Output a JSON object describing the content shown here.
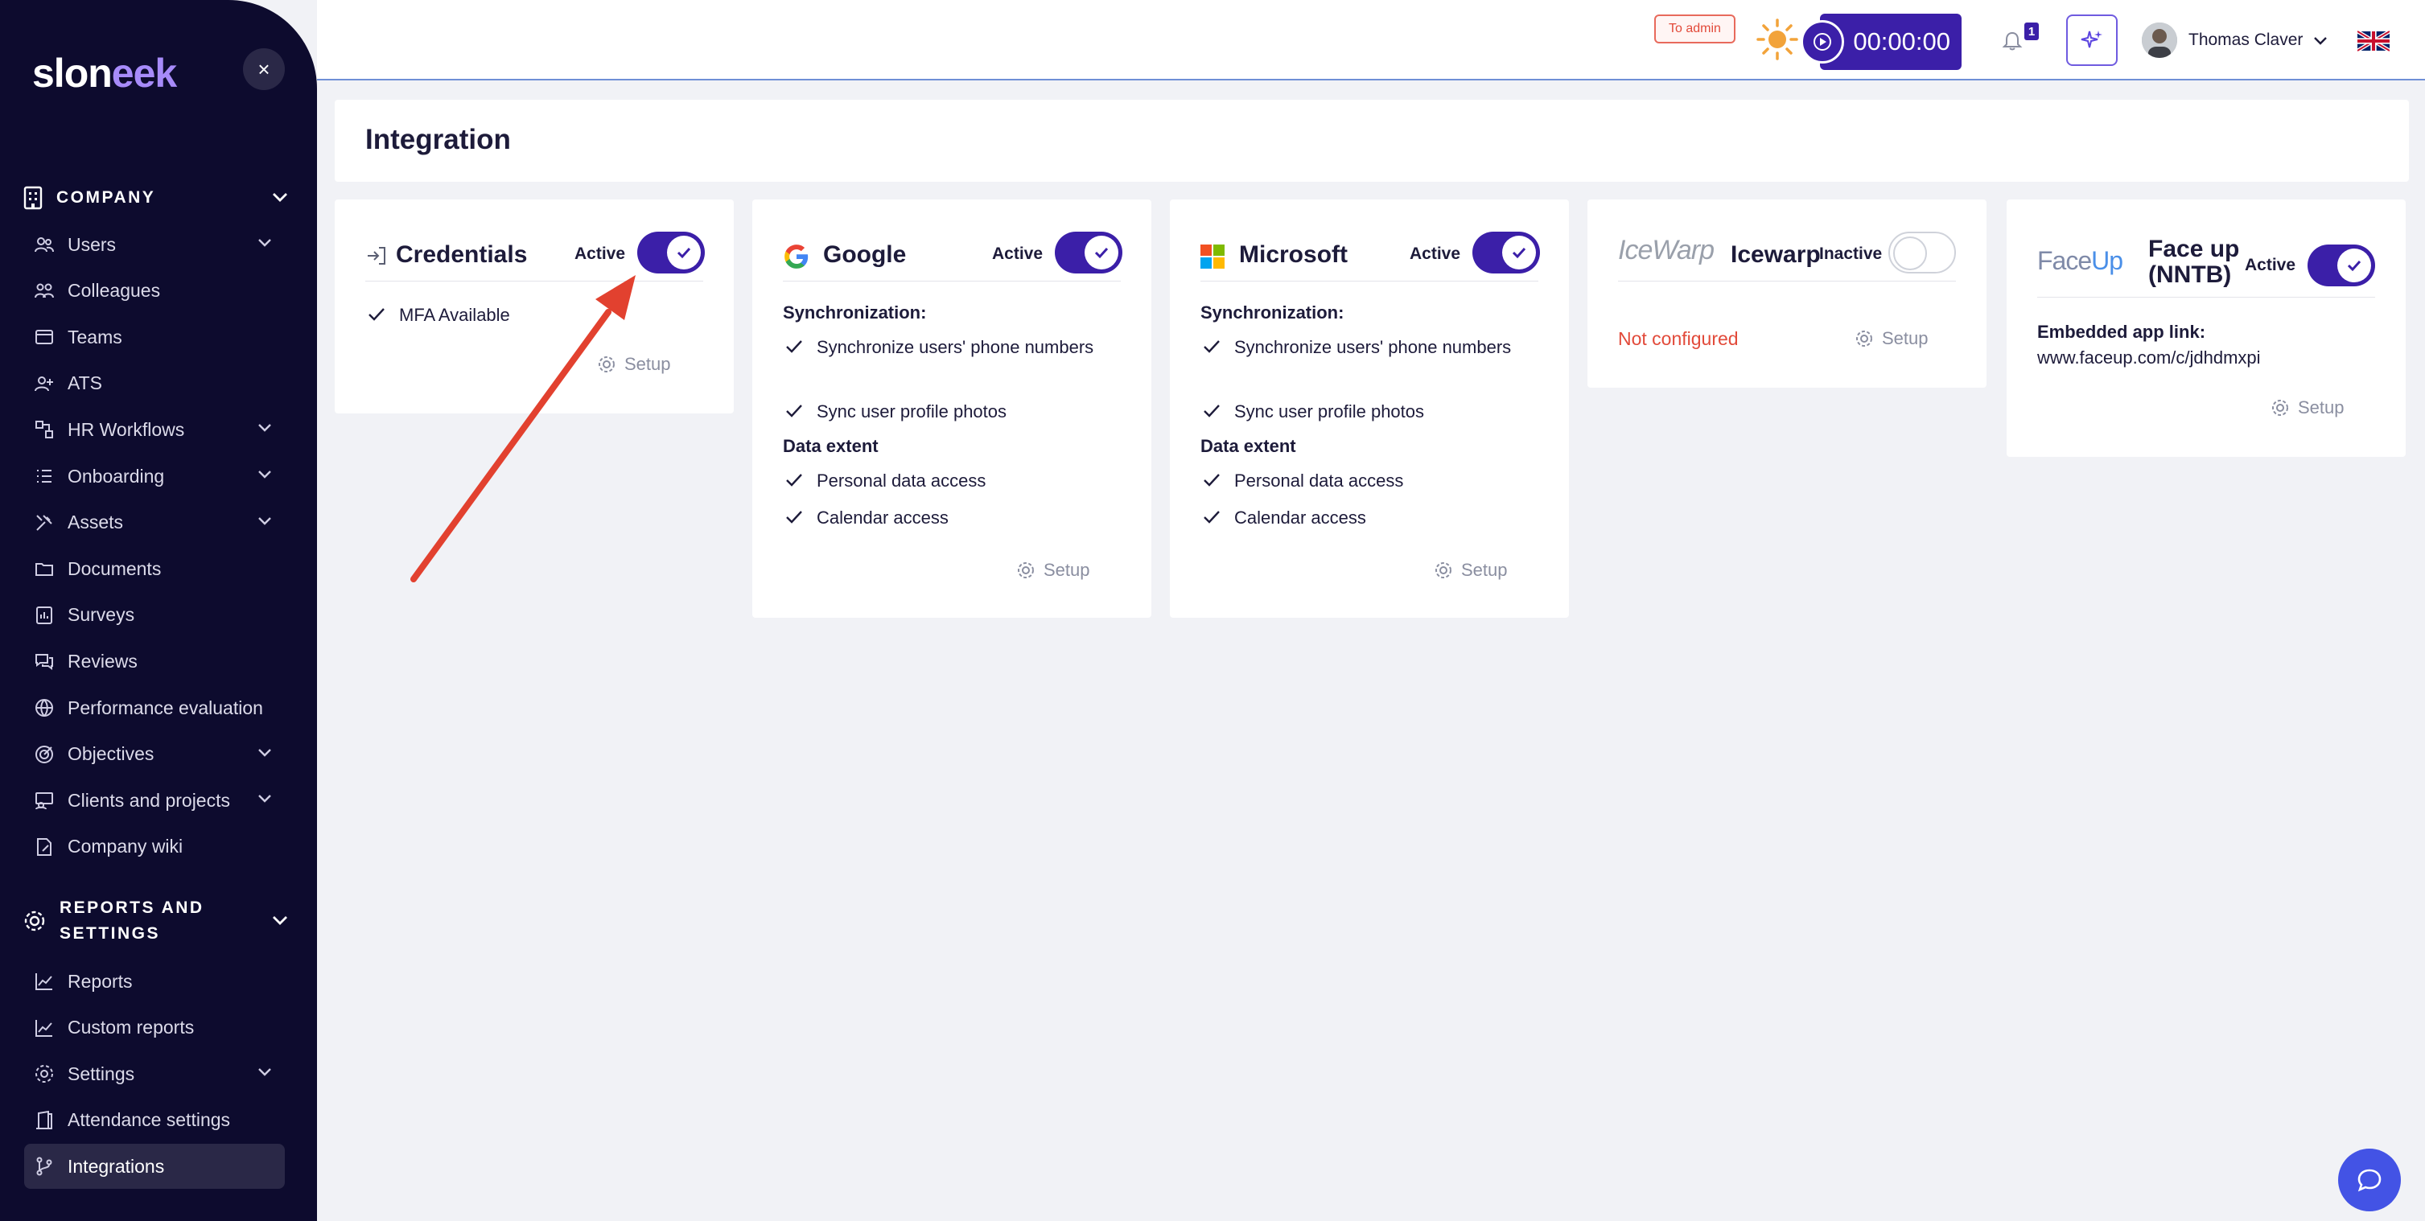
{
  "brand": {
    "logo_main": "slon",
    "logo_accent": "eek",
    "close_label": "×"
  },
  "sidebar": {
    "company_section": "COMPANY",
    "company_items": [
      {
        "label": "Users",
        "expandable": true
      },
      {
        "label": "Colleagues",
        "expandable": false
      },
      {
        "label": "Teams",
        "expandable": false
      },
      {
        "label": "ATS",
        "expandable": false
      },
      {
        "label": "HR Workflows",
        "expandable": true
      },
      {
        "label": "Onboarding",
        "expandable": true
      },
      {
        "label": "Assets",
        "expandable": true
      },
      {
        "label": "Documents",
        "expandable": false
      },
      {
        "label": "Surveys",
        "expandable": false
      },
      {
        "label": "Reviews",
        "expandable": false
      },
      {
        "label": "Performance evaluation",
        "expandable": false
      },
      {
        "label": "Objectives",
        "expandable": true
      },
      {
        "label": "Clients and projects",
        "expandable": true
      },
      {
        "label": "Company wiki",
        "expandable": false
      }
    ],
    "reports_section_line1": "REPORTS AND",
    "reports_section_line2": "SETTINGS",
    "reports_items": [
      {
        "label": "Reports",
        "expandable": false
      },
      {
        "label": "Custom reports",
        "expandable": false
      },
      {
        "label": "Settings",
        "expandable": true
      },
      {
        "label": "Attendance settings",
        "expandable": false
      },
      {
        "label": "Integrations",
        "expandable": false,
        "active": true
      }
    ]
  },
  "topbar": {
    "to_admin": "To admin",
    "timer": "00:00:00",
    "notification_count": "1",
    "user_name": "Thomas Claver"
  },
  "page": {
    "title": "Integration"
  },
  "cards": {
    "credentials": {
      "name": "Credentials",
      "status": "Active",
      "enabled": true,
      "items": [
        "MFA Available"
      ],
      "setup": "Setup"
    },
    "google": {
      "name": "Google",
      "status": "Active",
      "enabled": true,
      "sync_heading": "Synchronization:",
      "sync_items": [
        "Synchronize users' phone numbers",
        "Sync user profile photos"
      ],
      "extent_heading": "Data extent",
      "extent_items": [
        "Personal data access",
        "Calendar access"
      ],
      "setup": "Setup"
    },
    "microsoft": {
      "name": "Microsoft",
      "status": "Active",
      "enabled": true,
      "sync_heading": "Synchronization:",
      "sync_items": [
        "Synchronize users' phone numbers",
        "Sync user profile photos"
      ],
      "extent_heading": "Data extent",
      "extent_items": [
        "Personal data access",
        "Calendar access"
      ],
      "setup": "Setup"
    },
    "icewarp": {
      "logo_text": "IceWarp",
      "name": "Icewarp",
      "status": "Inactive",
      "enabled": false,
      "state_text": "Not configured",
      "setup": "Setup"
    },
    "faceup": {
      "logo_text_1": "Face",
      "logo_text_2": "Up",
      "name_line1": "Face up",
      "name_line2": "(NNTB)",
      "status": "Active",
      "enabled": true,
      "link_label": "Embedded app link:",
      "link_value": "www.faceup.com/c/jdhdmxpi",
      "setup": "Setup"
    }
  },
  "colors": {
    "sidebar_bg": "#0d0b2e",
    "accent": "#3b1fa8",
    "annotation_arrow": "#e2412f",
    "error": "#e24a3a"
  }
}
